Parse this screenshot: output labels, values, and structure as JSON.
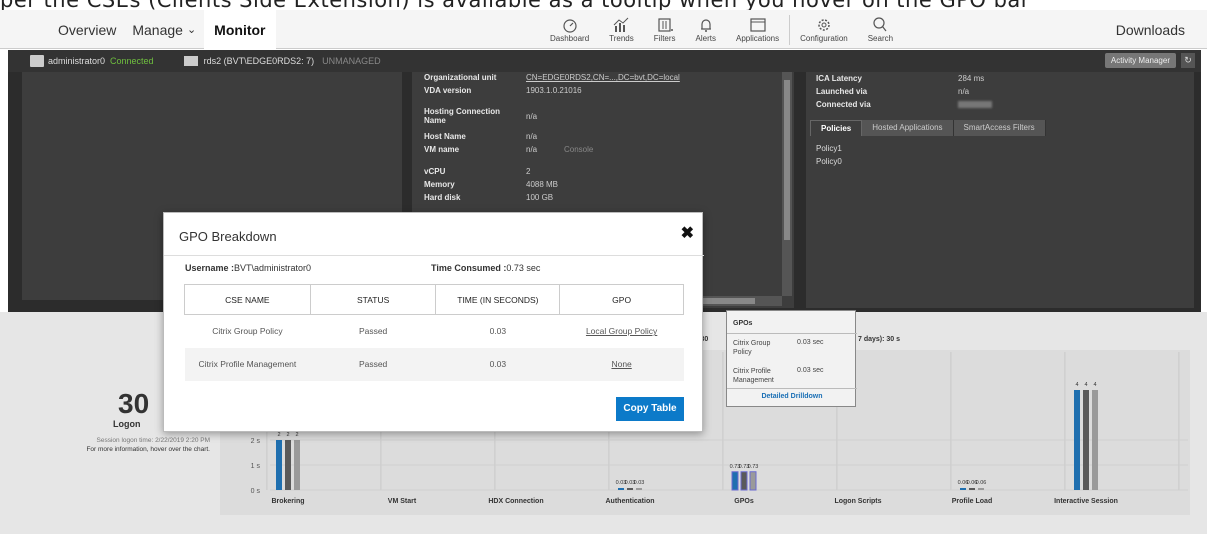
{
  "caption": "per the CSEs (Clients Side Extension) is available as a tooltip when you hover on the GPO bar",
  "nav": {
    "overview": "Overview",
    "manage": "Manage",
    "monitor": "Monitor",
    "icons": [
      {
        "label": "Dashboard"
      },
      {
        "label": "Trends"
      },
      {
        "label": "Filters"
      },
      {
        "label": "Alerts"
      },
      {
        "label": "Applications"
      },
      {
        "label": "Configuration"
      },
      {
        "label": "Search"
      }
    ],
    "downloads": "Downloads"
  },
  "session": {
    "user": "administrator0",
    "status": "Connected",
    "machine": "rds2 (BVT\\EDGE0RDS2: 7)",
    "managed": "UNMANAGED",
    "activity_manager": "Activity Manager",
    "refresh_icon": "refresh-icon"
  },
  "machine_details": [
    {
      "k": "Organizational unit",
      "v": "CN=EDGE0RDS2,CN=...,DC=bvt,DC=local"
    },
    {
      "k": "VDA version",
      "v": "1903.1.0.21016"
    },
    {
      "k": "Hosting Connection Name",
      "v": "n/a"
    },
    {
      "k": "Host Name",
      "v": "n/a"
    },
    {
      "k": "VM name",
      "v": "n/a",
      "extra": "Console"
    },
    {
      "k": "vCPU",
      "v": "2"
    },
    {
      "k": "Memory",
      "v": "4088 MB"
    },
    {
      "k": "Hard disk",
      "v": "100 GB"
    }
  ],
  "session_details": [
    {
      "k": "ICA Latency",
      "v": "284 ms"
    },
    {
      "k": "Launched via",
      "v": "n/a"
    },
    {
      "k": "Connected via",
      "v": ""
    }
  ],
  "right_tabs": [
    "Policies",
    "Hosted Applications",
    "SmartAccess Filters"
  ],
  "policies": [
    "Policy1",
    "Policy0"
  ],
  "logon": {
    "duration": "30",
    "label": "Logon",
    "session_time": "Session logon time: 2/22/2019 2:20 PM",
    "hint": "For more information, hover over the chart.",
    "avg_text_1": "s): 30",
    "avg_text_2": "7 days): 30 s"
  },
  "chart_data": {
    "type": "bar",
    "categories": [
      "Brokering",
      "VM Start",
      "HDX Connection",
      "Authentication",
      "GPOs",
      "Logon Scripts",
      "Profile Load",
      "Interactive Session"
    ],
    "series": [
      {
        "values": [
          2,
          null,
          null,
          0.03,
          0.73,
          null,
          0.06,
          4
        ]
      },
      {
        "values": [
          2,
          null,
          null,
          0.03,
          0.73,
          null,
          0.06,
          4
        ]
      },
      {
        "values": [
          2,
          null,
          null,
          0.03,
          0.73,
          null,
          0.06,
          4
        ]
      }
    ],
    "yticks": [
      "0 s",
      "1 s",
      "2 s"
    ],
    "colors": [
      "#1f6faf",
      "#5a5a5a",
      "#9a9a9a"
    ],
    "ylim": [
      0,
      4
    ]
  },
  "modal": {
    "title": "GPO Breakdown",
    "close_icon": "close-icon",
    "username_label": "Username :",
    "username": "BVT\\administrator0",
    "time_label": "Time Consumed :",
    "time": "0.73 sec",
    "columns": [
      "CSE NAME",
      "STATUS",
      "TIME (IN SECONDS)",
      "GPO"
    ],
    "rows": [
      {
        "cse": "Citrix Group Policy",
        "status": "Passed",
        "time": "0.03",
        "gpo": "Local Group Policy"
      },
      {
        "cse": "Citrix Profile Management",
        "status": "Passed",
        "time": "0.03",
        "gpo": "None"
      }
    ],
    "copy_button": "Copy Table"
  },
  "tooltip": {
    "title": "GPOs",
    "rows": [
      {
        "name": "Citrix Group Policy",
        "value": "0.03 sec"
      },
      {
        "name": "Citrix Profile Management",
        "value": "0.03 sec"
      }
    ],
    "drilldown": "Detailed Drilldown"
  }
}
